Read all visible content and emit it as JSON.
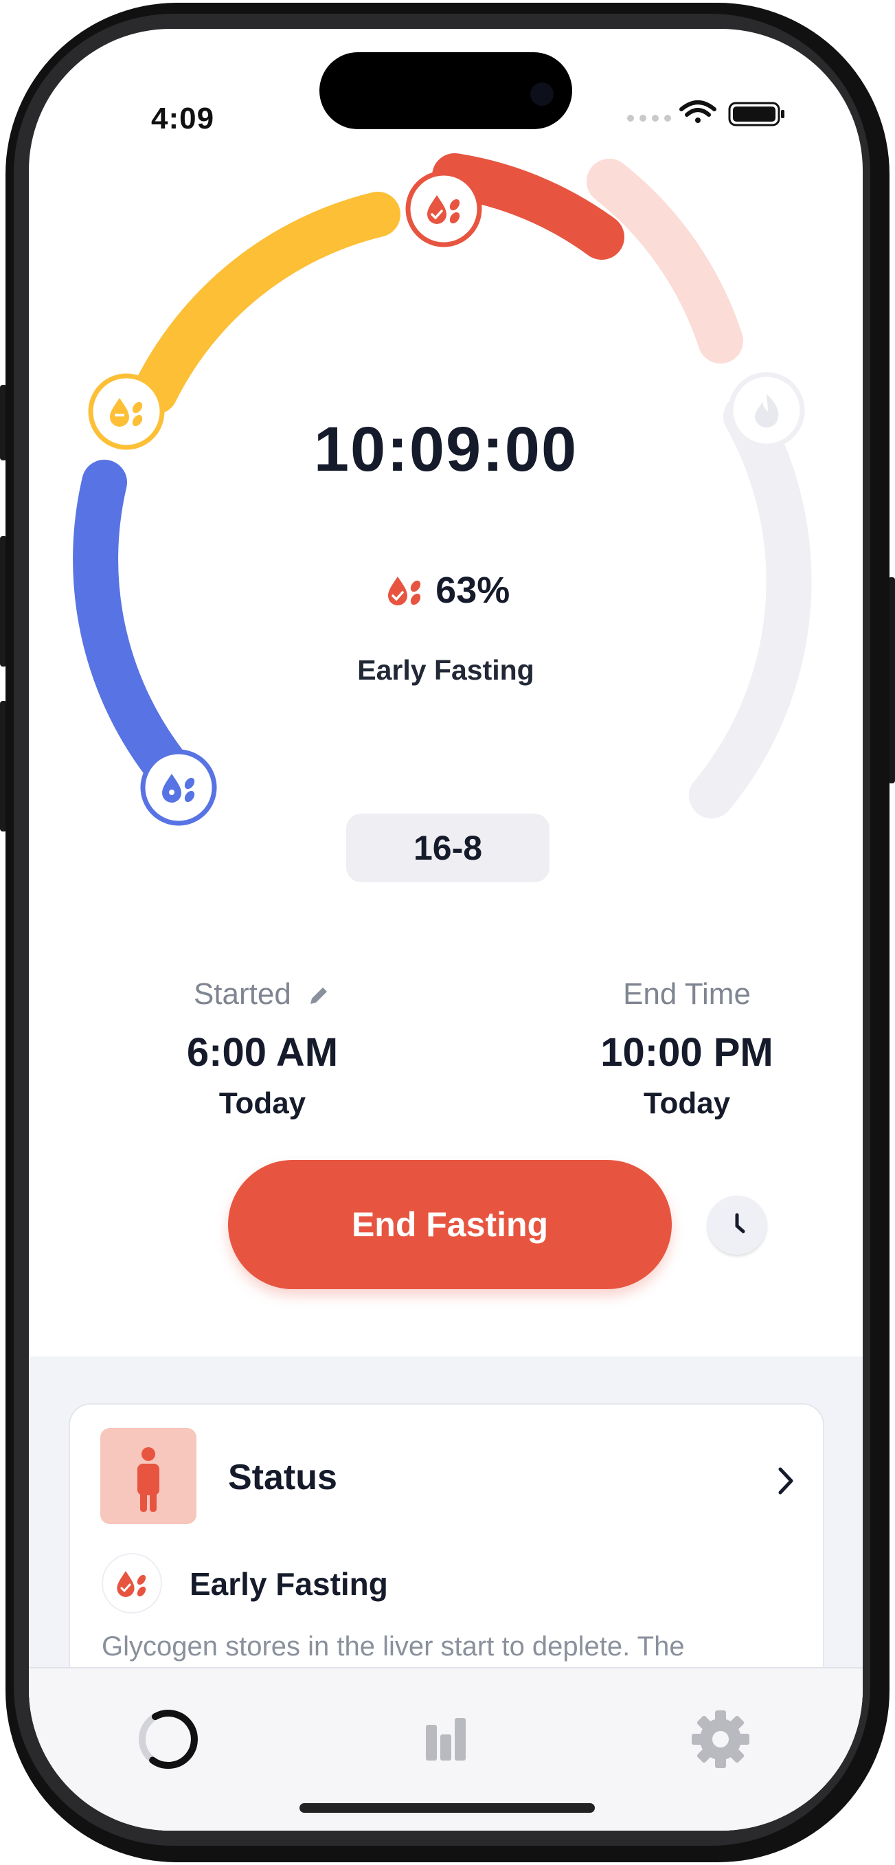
{
  "status_bar": {
    "time": "4:09"
  },
  "timer": {
    "elapsed": "10:09:00",
    "progress_percent": "63%",
    "progress_value": 63,
    "phase": "Early Fasting",
    "plan": "16-8"
  },
  "stages": [
    "blood-sugar-rising-icon",
    "blood-sugar-falling-icon",
    "early-fasting-icon",
    "fat-burning-icon"
  ],
  "colors": {
    "accent": "#e75540",
    "yellow": "#fcbf36",
    "blue": "#5873e3",
    "light_red": "#fcdcd6",
    "gray_track": "#efeff4"
  },
  "start": {
    "label": "Started",
    "time": "6:00 AM",
    "day": "Today"
  },
  "end": {
    "label": "End Time",
    "time": "10:00 PM",
    "day": "Today"
  },
  "actions": {
    "end_fasting": "End Fasting"
  },
  "status_card": {
    "title": "Status",
    "phase_title": "Early Fasting",
    "description": "Glycogen stores in the liver start to deplete. The"
  },
  "tabs": [
    {
      "name": "timer-tab",
      "icon": "ring-icon"
    },
    {
      "name": "stats-tab",
      "icon": "bar-chart-icon"
    },
    {
      "name": "settings-tab",
      "icon": "gear-icon"
    }
  ]
}
